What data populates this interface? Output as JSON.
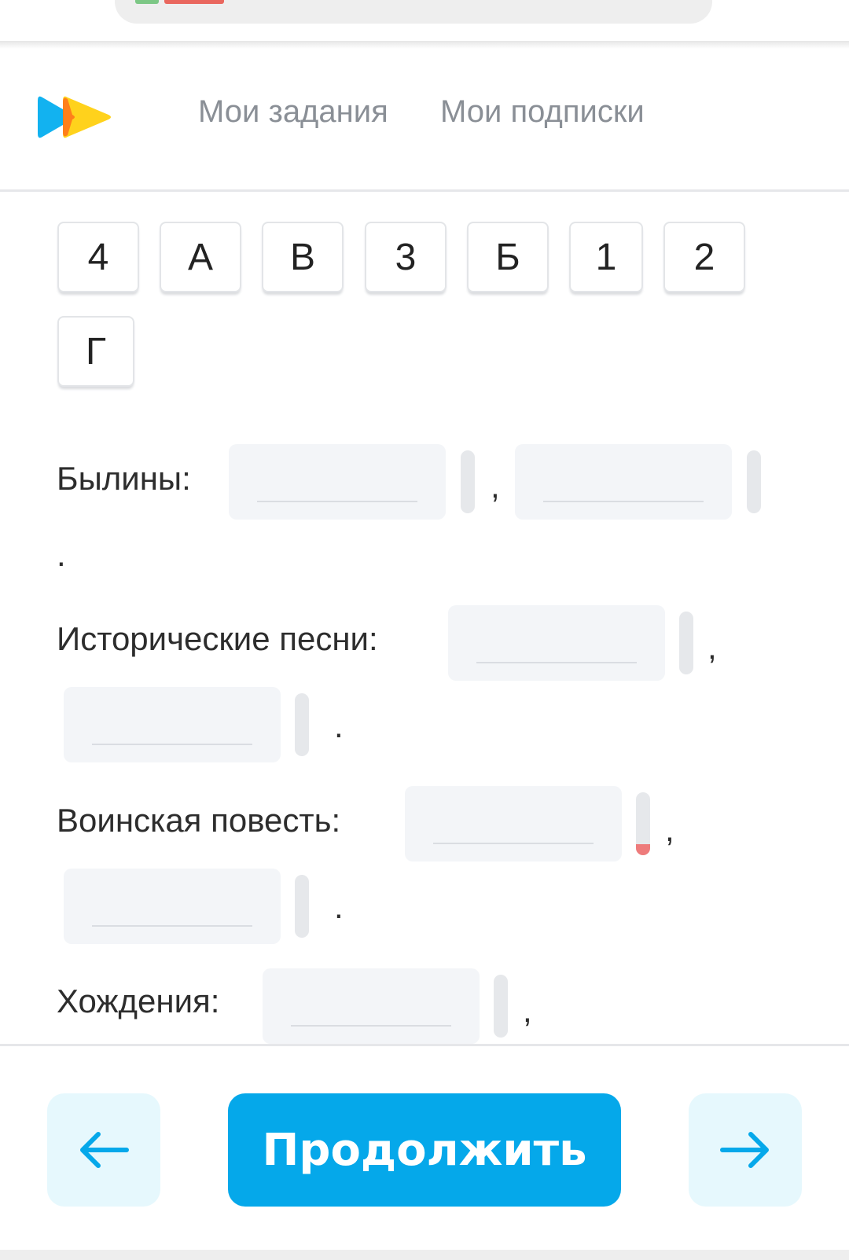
{
  "header": {
    "logo_icon": "play-arrows-logo-icon",
    "nav": [
      {
        "label": "Мои задания"
      },
      {
        "label": "Мои подписки"
      }
    ]
  },
  "options": [
    "4",
    "А",
    "В",
    "3",
    "Б",
    "1",
    "2",
    "Г"
  ],
  "rows": [
    {
      "label": "Былины:",
      "sep1": ",",
      "sep2": "."
    },
    {
      "label": "Исторические песни:",
      "sep1": ",",
      "sep2": "."
    },
    {
      "label": "Воинская повесть:",
      "sep1": ",",
      "sep2": "."
    },
    {
      "label": "Хождения:",
      "sep1": ","
    }
  ],
  "footer": {
    "prev_icon": "arrow-left-icon",
    "next_icon": "arrow-right-icon",
    "continue_label": "Продолжить"
  },
  "colors": {
    "accent": "#05a8ea",
    "nav_button_bg": "#e6f8fd",
    "field_bg": "#f3f5f8",
    "error": "#ee7b7b"
  }
}
